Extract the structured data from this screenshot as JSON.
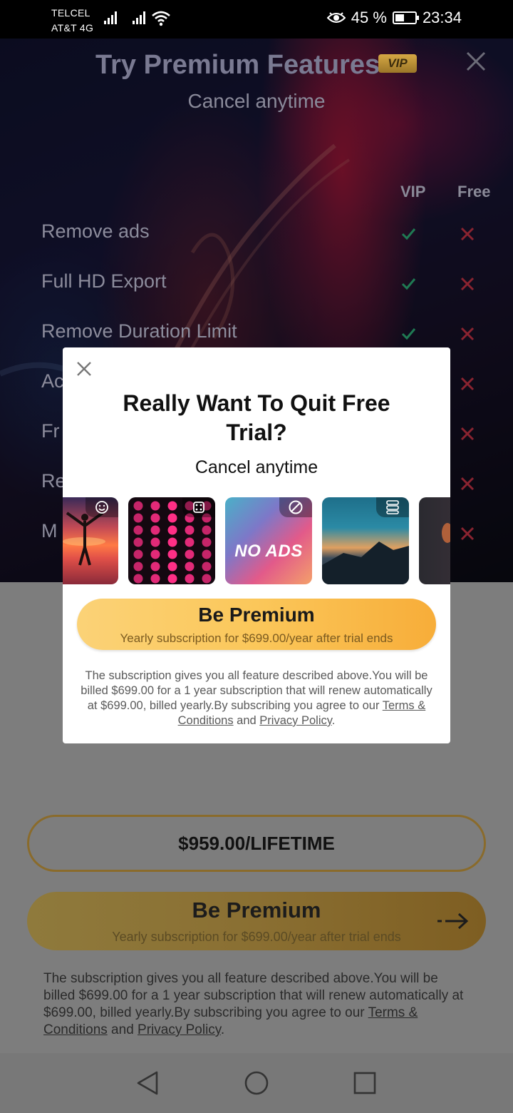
{
  "status_bar": {
    "carrier1": "TELCEL",
    "carrier2": "AT&T 4G",
    "battery_percent": "45 %",
    "battery_level": 0.45,
    "time": "23:34"
  },
  "premium_page": {
    "title": "Try Premium Features",
    "vip_badge": "VIP",
    "subtitle": "Cancel anytime",
    "col_vip": "VIP",
    "col_free": "Free",
    "features": [
      {
        "label": "Remove ads",
        "vip": true,
        "free": false
      },
      {
        "label": "Full HD Export",
        "vip": true,
        "free": false
      },
      {
        "label": "Remove Duration Limit",
        "vip": true,
        "free": false
      },
      {
        "label": "Ac",
        "vip": true,
        "free": false
      },
      {
        "label": "Fr",
        "vip": true,
        "free": false
      },
      {
        "label": "Re",
        "vip": true,
        "free": false
      },
      {
        "label": "M",
        "vip": true,
        "free": false
      }
    ],
    "lifetime_label": "$959.00/LIFETIME",
    "cta_label": "Be Premium",
    "cta_sub": "Yearly subscription for $699.00/year after trial ends",
    "legal_text": "The subscription gives you all feature described above.You will be billed $699.00 for a 1 year subscription that will renew automatically at $699.00, billed yearly.By subscribing you agree to our ",
    "terms_link": "Terms & Conditions",
    "and_text": " and ",
    "privacy_link": "Privacy Policy",
    "end_text": "."
  },
  "dialog": {
    "title": "Really Want To Quit Free Trial?",
    "subtitle": "Cancel anytime",
    "thumbs": [
      {
        "name": "sunset-person",
        "icon": "smiley-icon"
      },
      {
        "name": "pink-dots",
        "icon": "dice-icon"
      },
      {
        "name": "no-ads",
        "icon": "block-icon",
        "text": "NO ADS"
      },
      {
        "name": "mountain-sky",
        "icon": "layers-icon"
      },
      {
        "name": "partial-photo",
        "icon": ""
      }
    ],
    "cta_label": "Be Premium",
    "cta_sub": "Yearly subscription for $699.00/year after trial ends",
    "legal_text": "The subscription gives you all feature described above.You will be billed $699.00 for a 1 year subscription that will renew automatically at $699.00, billed yearly.By subscribing you agree to our ",
    "terms_link": "Terms & Conditions",
    "and_text": " and ",
    "privacy_link": "Privacy Policy",
    "end_text": "."
  },
  "nav_bar": {
    "back": "back-icon",
    "home": "home-icon",
    "recents": "recents-icon"
  },
  "colors": {
    "check": "#1f7a53",
    "cross": "#8a2330",
    "gold": "#fbc75a"
  }
}
